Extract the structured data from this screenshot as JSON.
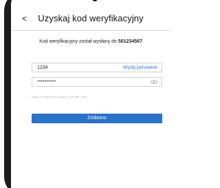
{
  "header": {
    "back_glyph": "<",
    "title": "Uzyskaj kod weryfikacyjny"
  },
  "info": {
    "message": "Kod weryfikacyjny został wysłany do ",
    "phone": "501234567"
  },
  "code_field": {
    "value": "1234",
    "resend_label": "Wyślij ponownie"
  },
  "password_field": {
    "value": "**********",
    "toggle_icon": "eye-icon"
  },
  "hint": "Hasło co najmniej 8 znaków, w tym liter i cyfr",
  "submit": {
    "label": "Zrobiono"
  },
  "colors": {
    "accent": "#2b72c9",
    "link": "#2f7fd8",
    "frame": "#1c1c1e"
  }
}
